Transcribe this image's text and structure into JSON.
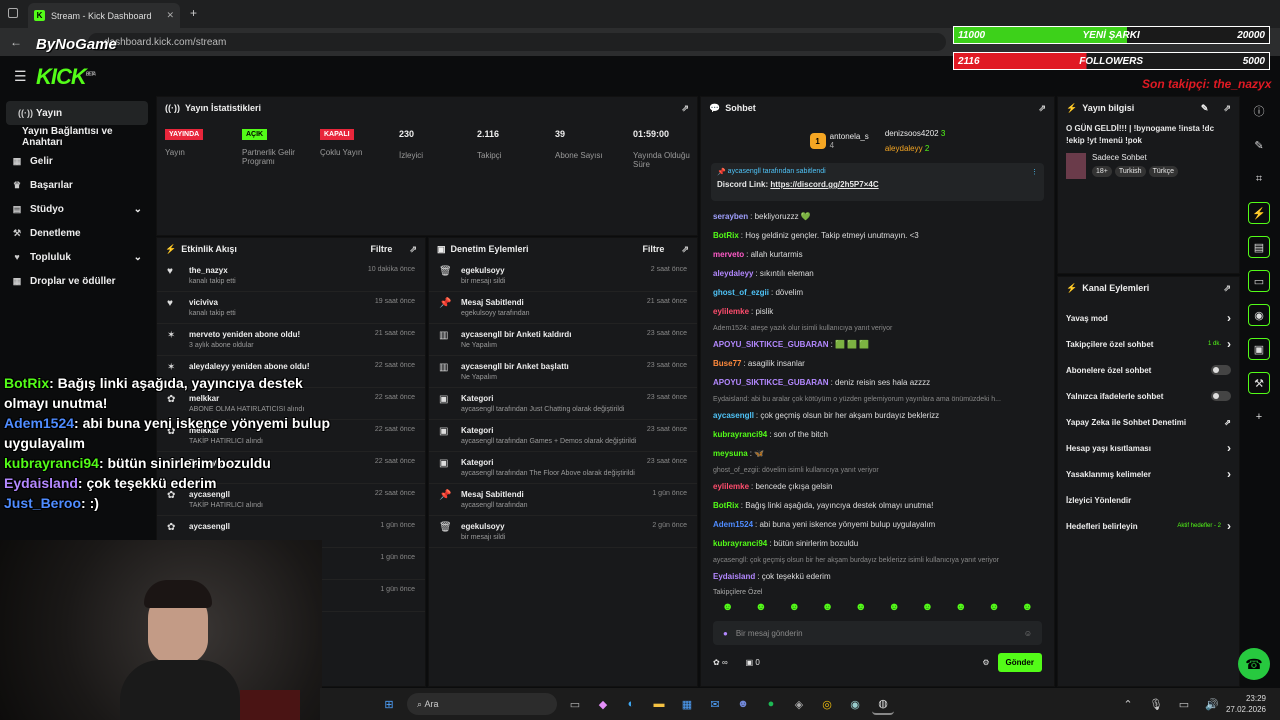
{
  "browser": {
    "tab_title": "Stream - Kick Dashboard",
    "url": "dashboard.kick.com/stream",
    "new_tab": "+",
    "kick_favicon": "K"
  },
  "overlay": {
    "watermark": "ByNoGame",
    "song_current": "11000",
    "song_label": "YENİ ŞARKI",
    "song_target": "20000",
    "song_progress": 0.55,
    "followers_current": "2116",
    "followers_label": "FOLLOWERS",
    "followers_target": "5000",
    "followers_progress": 0.42,
    "last_follower": "Son takipçi: the_nazyx"
  },
  "header": {
    "logo": "KICK",
    "logo_beta": "BETA"
  },
  "sidebar": {
    "items": [
      {
        "icon": "broadcast-icon",
        "label": "Yayın",
        "glyph": "((·))"
      },
      {
        "icon": "",
        "label": "Yayın Bağlantısı ve Anahtarı",
        "glyph": ""
      },
      {
        "icon": "income-icon",
        "label": "Gelir",
        "glyph": "▦"
      },
      {
        "icon": "trophy-icon",
        "label": "Başarılar",
        "glyph": "🏆"
      },
      {
        "icon": "studio-icon",
        "label": "Stüdyo",
        "glyph": "▤"
      },
      {
        "icon": "wrench-icon",
        "label": "Denetleme",
        "glyph": "🔨"
      },
      {
        "icon": "community-icon",
        "label": "Topluluk",
        "glyph": "♥"
      },
      {
        "icon": "gift-icon",
        "label": "Droplar ve ödüller",
        "glyph": "▦"
      }
    ]
  },
  "stats": {
    "title": "Yayın İstatistikleri",
    "items": [
      {
        "badge": "YAYINDA",
        "badge_color": "#e8263b",
        "label": "Yayın"
      },
      {
        "badge": "AÇIK",
        "badge_color": "#53fc18",
        "label": "Partnerlik Gelir Programı"
      },
      {
        "badge": "KAPALI",
        "badge_color": "#e8263b",
        "label": "Çoklu Yayın"
      },
      {
        "value": "230",
        "label": "İzleyici"
      },
      {
        "value": "2.116",
        "label": "Takipçi"
      },
      {
        "value": "39",
        "label": "Abone Sayısı"
      },
      {
        "value": "01:59:00",
        "label": "Yayında Olduğu Süre"
      }
    ]
  },
  "activity": {
    "title": "Etkinlik Akışı",
    "filter": "Filtre",
    "events": [
      {
        "icon": "♥",
        "name": "the_nazyx",
        "sub": "kanalı takip etti",
        "time": "10 dakika önce"
      },
      {
        "icon": "♥",
        "name": "viciviva",
        "sub": "kanalı takip etti",
        "time": "19 saat önce"
      },
      {
        "icon": "✶",
        "name": "merveto yeniden abone oldu!",
        "sub": "3 aylık abone oldular",
        "time": "21 saat önce"
      },
      {
        "icon": "✶",
        "name": "aleydaleyy yeniden abone oldu!",
        "sub": "",
        "time": "22 saat önce"
      },
      {
        "icon": "✿",
        "name": "melkkar",
        "sub": "ABONE OLMA HATIRLATICISI alındı",
        "time": "22 saat önce"
      },
      {
        "icon": "✿",
        "name": "melkkar",
        "sub": "TAKİP HATIRLICI alındı",
        "time": "22 saat önce"
      },
      {
        "icon": "✿",
        "name": "Tuanayilmazz",
        "sub": "",
        "time": "22 saat önce"
      },
      {
        "icon": "✿",
        "name": "aycasengll",
        "sub": "TAKİP HATIRLICI alındı",
        "time": "22 saat önce"
      },
      {
        "icon": "✿",
        "name": "aycasengll",
        "sub": "",
        "time": "1 gün önce"
      },
      {
        "icon": "",
        "name": "",
        "sub": "",
        "time": "1 gün önce"
      },
      {
        "icon": "",
        "name": "",
        "sub": "",
        "time": "1 gün önce"
      }
    ]
  },
  "moderation": {
    "title": "Denetim Eylemleri",
    "filter": "Filtre",
    "events": [
      {
        "icon": "🗑",
        "name": "egekulsoyy",
        "sub": "bir mesajı sildi",
        "time": "2 saat önce"
      },
      {
        "icon": "📌",
        "name": "Mesaj Sabitlendi",
        "sub": "egekulsoyy tarafından",
        "time": "21 saat önce"
      },
      {
        "icon": "▥",
        "name": "aycasengll bir Anketi kaldırdı",
        "sub": "Ne Yapalım",
        "time": "23 saat önce"
      },
      {
        "icon": "▥",
        "name": "aycasengll bir Anket başlattı",
        "sub": "Ne Yapalım",
        "time": "23 saat önce"
      },
      {
        "icon": "▣",
        "name": "Kategori",
        "sub": "aycasengll tarafından Just Chatting olarak değiştirildi",
        "time": "23 saat önce"
      },
      {
        "icon": "▣",
        "name": "Kategori",
        "sub": "aycasengll tarafından Games + Demos olarak değiştirildi",
        "time": "23 saat önce"
      },
      {
        "icon": "▣",
        "name": "Kategori",
        "sub": "aycasengll tarafından The Floor Above olarak değiştirildi",
        "time": "23 saat önce"
      },
      {
        "icon": "📌",
        "name": "Mesaj Sabitlendi",
        "sub": "aycasengll tarafından",
        "time": "1 gün önce"
      },
      {
        "icon": "🗑",
        "name": "egekulsoyy",
        "sub": "bir mesajı sildi",
        "time": "2 gün önce"
      }
    ]
  },
  "chat": {
    "title": "Sohbet",
    "top": [
      {
        "name": "antonela_s",
        "n": "4"
      },
      {
        "name": "denizsoos4202",
        "n": "3"
      },
      {
        "name": "aleydaleyy",
        "n": "2"
      }
    ],
    "pinned_by": "aycasengll tarafından sabitlendi",
    "pinned_text": "Discord Link:",
    "pinned_link": "https://discord.gg/2h5P7×4C",
    "messages": [
      {
        "user": "serayben",
        "color": "#a0a0ff",
        "text": ": bekliyoruzzz 💚"
      },
      {
        "user": "BotRix",
        "color": "#53fc18",
        "text": ": Hoş geldiniz gençler. Takip etmeyi unutmayın. <3"
      },
      {
        "user": "merveto",
        "color": "#ff5bc8",
        "text": ": allah kurtarmis"
      },
      {
        "user": "aleydaleyy",
        "color": "#b388ff",
        "text": ": sıkıntılı eleman"
      },
      {
        "user": "ghost_of_ezgii",
        "color": "#4fc3f7",
        "text": ": dövelim"
      },
      {
        "user": "eylilemke",
        "color": "#ff4d6d",
        "text": ": pislik"
      },
      {
        "user": "",
        "color": "#888",
        "text": "Adem1524: ateşe yazık olur isimli kullanıcıya yanıt veriyor",
        "sys": true
      },
      {
        "user": "APOYU_SIKTIKCE_GUBARAN",
        "color": "#b388ff",
        "text": ": 🟩 🟩 🟩"
      },
      {
        "user": "Buse77",
        "color": "#ff8a3d",
        "text": ": asagilik insanlar"
      },
      {
        "user": "APOYU_SIKTIKCE_GUBARAN",
        "color": "#b388ff",
        "text": ": deniz reisin ses hala azzzz"
      },
      {
        "user": "",
        "color": "#888",
        "text": "Eydaisland: abi bu aralar çok kötüyüm o yüzden gelemiyorum yayınlara ama önümüzdeki h...",
        "sys": true
      },
      {
        "user": "aycasengll",
        "color": "#4fc3f7",
        "text": ": çok geçmiş olsun bir her akşam burdayız beklerizz"
      },
      {
        "user": "kubrayranci94",
        "color": "#53fc18",
        "text": ": son of the bitch"
      },
      {
        "user": "meysuna",
        "color": "#53fc18",
        "text": ": 🦋"
      },
      {
        "user": "",
        "color": "#888",
        "text": "ghost_of_ezgii: dövelim isimli kullanıcıya yanıt veriyor",
        "sys": true
      },
      {
        "user": "eylilemke",
        "color": "#ff4d6d",
        "text": ": bencede çıkışa gelsin"
      },
      {
        "user": "BotRix",
        "color": "#53fc18",
        "text": ": Bağış linki aşağıda, yayıncıya destek olmayı unutma!"
      },
      {
        "user": "Adem1524",
        "color": "#4f8cff",
        "text": ": abi buna yeni iskence yönyemi bulup uygulayalım"
      },
      {
        "user": "kubrayranci94",
        "color": "#53fc18",
        "text": ": bütün sinirlerim bozuldu"
      },
      {
        "user": "",
        "color": "#888",
        "text": "aycasengll: çok geçmiş olsun bir her akşam burdayız beklerizz isimli kullanıcıya yanıt veriyor",
        "sys": true
      },
      {
        "user": "Eydaisland",
        "color": "#b388ff",
        "text": ": çok teşekkü ederim"
      },
      {
        "user": "Just_Beroo",
        "color": "#4f8cff",
        "text": ": :)"
      }
    ],
    "followers_only": "Takipçilere Özel",
    "input_placeholder": "Bir mesaj gönderin",
    "send": "Gönder",
    "points": "∞",
    "box_count": "0"
  },
  "stream_info": {
    "title": "Yayın bilgisi",
    "text": "O GÜN GELDİ!!! | !bynogame !insta !dc !ekip !yt !menü !pok",
    "category": "Sadece Sohbet",
    "tags": [
      "18+",
      "Turkish",
      "Türkçe"
    ]
  },
  "channel_actions": {
    "title": "Kanal Eylemleri",
    "items": [
      {
        "label": "Yavaş mod",
        "type": "chevron"
      },
      {
        "label": "Takipçilere özel sohbet",
        "sub": "1 dk.",
        "type": "chevron"
      },
      {
        "label": "Abonelere özel sohbet",
        "type": "toggle"
      },
      {
        "label": "Yalnızca ifadelerle sohbet",
        "type": "toggle"
      },
      {
        "label": "Yapay Zeka ile Sohbet Denetimi",
        "type": "external"
      },
      {
        "label": "Hesap yaşı kısıtlaması",
        "type": "chevron"
      },
      {
        "label": "Yasaklanmış kelimeler",
        "type": "chevron"
      },
      {
        "label": "İzleyici Yönlendir",
        "type": "none"
      },
      {
        "label": "Hedefleri belirleyin",
        "sub": "Aktif hedefler - 2",
        "type": "chevron"
      }
    ]
  },
  "overlay_chat": [
    {
      "user": "BotRix",
      "color": "#53fc18",
      "text": ": Bağış linki aşağıda, yayıncıya destek olmayı unutma!"
    },
    {
      "user": "Adem1524",
      "color": "#4f8cff",
      "text": ": abi buna yeni iskence yönyemi bulup uygulayalım"
    },
    {
      "user": "kubrayranci94",
      "color": "#53fc18",
      "text": ": bütün sinirlerim bozuldu"
    },
    {
      "user": "Eydaisland",
      "color": "#b388ff",
      "text": ": çok teşekkü ederim"
    },
    {
      "user": "Just_Beroo",
      "color": "#4f8cff",
      "text": ": :)"
    }
  ],
  "taskbar": {
    "search": "Ara",
    "time": "23:29",
    "date": "27.02.2026"
  }
}
